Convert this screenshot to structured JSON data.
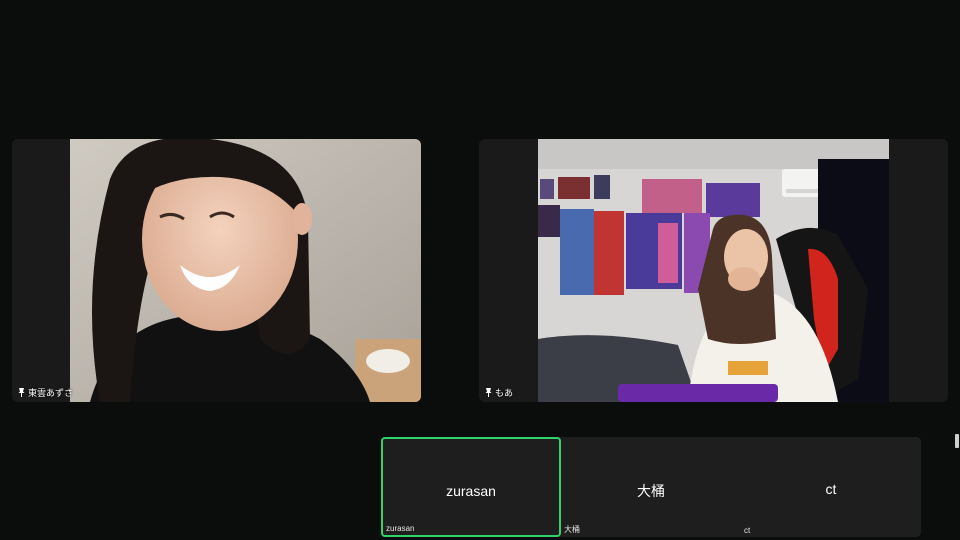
{
  "participants": [
    {
      "name": "東雲あずさ",
      "pinned": true
    },
    {
      "name": "もあ",
      "pinned": true
    }
  ],
  "thumbnails": [
    {
      "display_name": "zurasan",
      "label": "zurasan",
      "active": true
    },
    {
      "display_name": "大桶",
      "label": "大桶",
      "active": false
    },
    {
      "display_name": "ct",
      "label": "ct",
      "active": false
    }
  ],
  "colors": {
    "active_speaker": "#2fd36a",
    "background": "#0b0d0c",
    "tile": "#1a1a1a"
  },
  "icons": {
    "pin": "pin-icon"
  }
}
